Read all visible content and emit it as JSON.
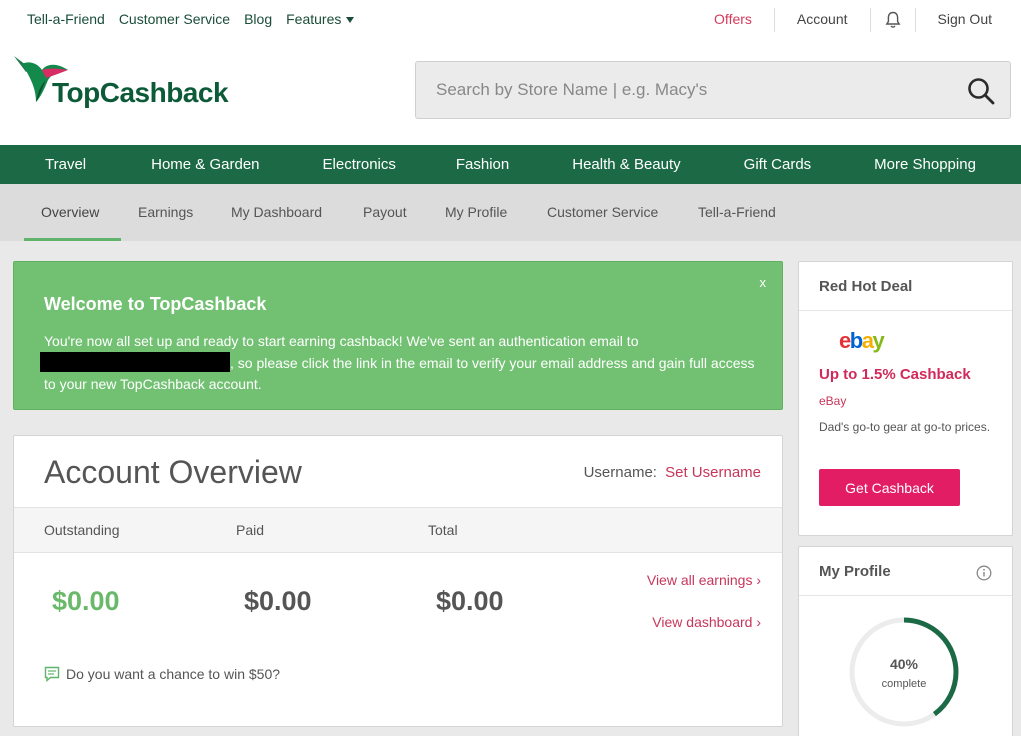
{
  "header": {
    "util_left": [
      "Tell-a-Friend",
      "Customer Service",
      "Blog",
      "Features"
    ],
    "offers": "Offers",
    "account": "Account",
    "sign_out": "Sign Out",
    "logo_text": "TopCashback",
    "search_placeholder": "Search by Store Name | e.g. Macy's"
  },
  "main_nav": [
    "Travel",
    "Home & Garden",
    "Electronics",
    "Fashion",
    "Health & Beauty",
    "Gift Cards",
    "More Shopping"
  ],
  "sub_nav": {
    "active": "Overview",
    "tabs": [
      "Overview",
      "Earnings",
      "My Dashboard",
      "Payout",
      "My Profile",
      "Customer Service",
      "Tell-a-Friend"
    ]
  },
  "welcome": {
    "title": "Welcome to TopCashback",
    "close": "x",
    "msg_before": "You're now all set up and ready to start earning cashback! We've sent an authentication email to",
    "msg_after": ", so please click the link in the email to verify your email address and gain full access to your new TopCashback account."
  },
  "account": {
    "title": "Account Overview",
    "username_label": "Username:",
    "username_link": "Set Username",
    "headers": [
      "Outstanding",
      "Paid",
      "Total"
    ],
    "amounts": [
      "$0.00",
      "$0.00",
      "$0.00"
    ],
    "view_earnings": "View all earnings ›",
    "view_dashboard": "View dashboard ›",
    "win_text": "Do you want a chance to win $50?"
  },
  "deal": {
    "title": "Red Hot Deal",
    "logo_letters": [
      "e",
      "b",
      "a",
      "y"
    ],
    "logo_colors": [
      "#e53238",
      "#0064d2",
      "#f5af02",
      "#86b817"
    ],
    "offer": "Up to 1.5% Cashback",
    "store": "eBay",
    "desc": "Dad's go-to gear at go-to prices.",
    "button": "Get Cashback"
  },
  "profile": {
    "title": "My Profile",
    "percent": "40%",
    "label": "complete",
    "progress": 0.4
  },
  "colors": {
    "brand_green": "#1c6a45",
    "accent_pink": "#e31d63",
    "welcome_green": "#72c173"
  }
}
